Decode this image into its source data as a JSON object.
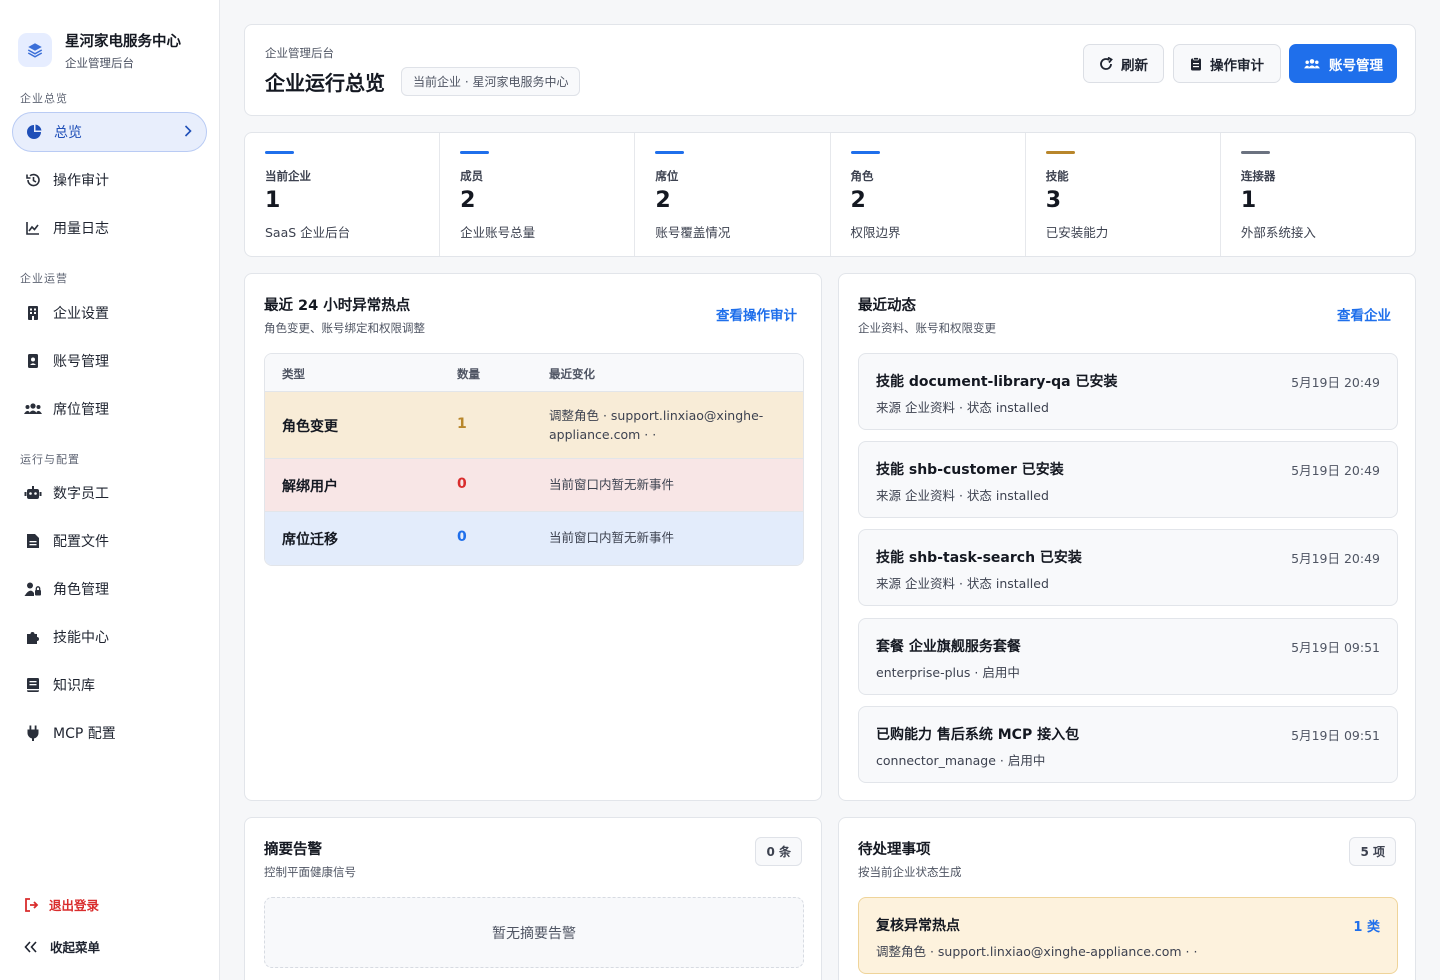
{
  "brand": {
    "title": "星河家电服务中心",
    "subtitle": "企业管理后台"
  },
  "sidebar": {
    "sections": [
      "企业总览",
      "企业运营",
      "运行与配置"
    ],
    "items": [
      {
        "label": "总览",
        "icon": "pie-chart-icon",
        "active": true
      },
      {
        "label": "操作审计",
        "icon": "history-icon"
      },
      {
        "label": "用量日志",
        "icon": "line-chart-icon"
      },
      {
        "label": "企业设置",
        "icon": "building-icon"
      },
      {
        "label": "账号管理",
        "icon": "id-badge-icon"
      },
      {
        "label": "席位管理",
        "icon": "users-icon"
      },
      {
        "label": "数字员工",
        "icon": "robot-icon"
      },
      {
        "label": "配置文件",
        "icon": "file-icon"
      },
      {
        "label": "角色管理",
        "icon": "user-lock-icon"
      },
      {
        "label": "技能中心",
        "icon": "puzzle-icon"
      },
      {
        "label": "知识库",
        "icon": "book-icon"
      },
      {
        "label": "MCP 配置",
        "icon": "plug-icon"
      }
    ],
    "logout": "退出登录",
    "collapse": "收起菜单"
  },
  "header": {
    "eyebrow": "企业管理后台",
    "title": "企业运行总览",
    "chip": "当前企业 · 星河家电服务中心",
    "buttons": {
      "refresh": "刷新",
      "audit": "操作审计",
      "accounts": "账号管理"
    }
  },
  "stats": [
    {
      "label": "当前企业",
      "value": "1",
      "sub": "SaaS 企业后台",
      "color": "#1f6feb"
    },
    {
      "label": "成员",
      "value": "2",
      "sub": "企业账号总量",
      "color": "#1f6feb"
    },
    {
      "label": "席位",
      "value": "2",
      "sub": "账号覆盖情况",
      "color": "#1f6feb"
    },
    {
      "label": "角色",
      "value": "2",
      "sub": "权限边界",
      "color": "#1f6feb"
    },
    {
      "label": "技能",
      "value": "3",
      "sub": "已安装能力",
      "color": "#b8862b"
    },
    {
      "label": "连接器",
      "value": "1",
      "sub": "外部系统接入",
      "color": "#6b7280"
    }
  ],
  "hotspots": {
    "title": "最近 24 小时异常热点",
    "subtitle": "角色变更、账号绑定和权限调整",
    "link": "查看操作审计",
    "columns": [
      "类型",
      "数量",
      "最近变化"
    ],
    "rows": [
      {
        "type": "角色变更",
        "count": "1",
        "change": "调整角色 · support.linxiao@xinghe-appliance.com · ·",
        "bg": "#f8ecd7",
        "countColor": "#b8862b"
      },
      {
        "type": "解绑用户",
        "count": "0",
        "change": "当前窗口内暂无新事件",
        "bg": "#f8e6e6",
        "countColor": "#d92d2d"
      },
      {
        "type": "席位迁移",
        "count": "0",
        "change": "当前窗口内暂无新事件",
        "bg": "#e3ecfb",
        "countColor": "#1f6feb"
      }
    ]
  },
  "activity": {
    "title": "最近动态",
    "subtitle": "企业资料、账号和权限变更",
    "link": "查看企业",
    "items": [
      {
        "title": "技能 document-library-qa 已安装",
        "meta": "来源 企业资料 · 状态 installed",
        "time": "5月19日 20:49"
      },
      {
        "title": "技能 shb-customer 已安装",
        "meta": "来源 企业资料 · 状态 installed",
        "time": "5月19日 20:49"
      },
      {
        "title": "技能 shb-task-search 已安装",
        "meta": "来源 企业资料 · 状态 installed",
        "time": "5月19日 20:49"
      },
      {
        "title": "套餐 企业旗舰服务套餐",
        "meta": "enterprise-plus · 启用中",
        "time": "5月19日 09:51"
      },
      {
        "title": "已购能力 售后系统 MCP 接入包",
        "meta": "connector_manage · 启用中",
        "time": "5月19日 09:51"
      }
    ]
  },
  "alerts": {
    "title": "摘要告警",
    "subtitle": "控制平面健康信号",
    "badge": "0 条",
    "empty": "暂无摘要告警"
  },
  "pending": {
    "title": "待处理事项",
    "subtitle": "按当前企业状态生成",
    "badge": "5 项",
    "item": {
      "title": "复核异常热点",
      "meta": "调整角色 · support.linxiao@xinghe-appliance.com · ·",
      "count": "1 类"
    }
  }
}
